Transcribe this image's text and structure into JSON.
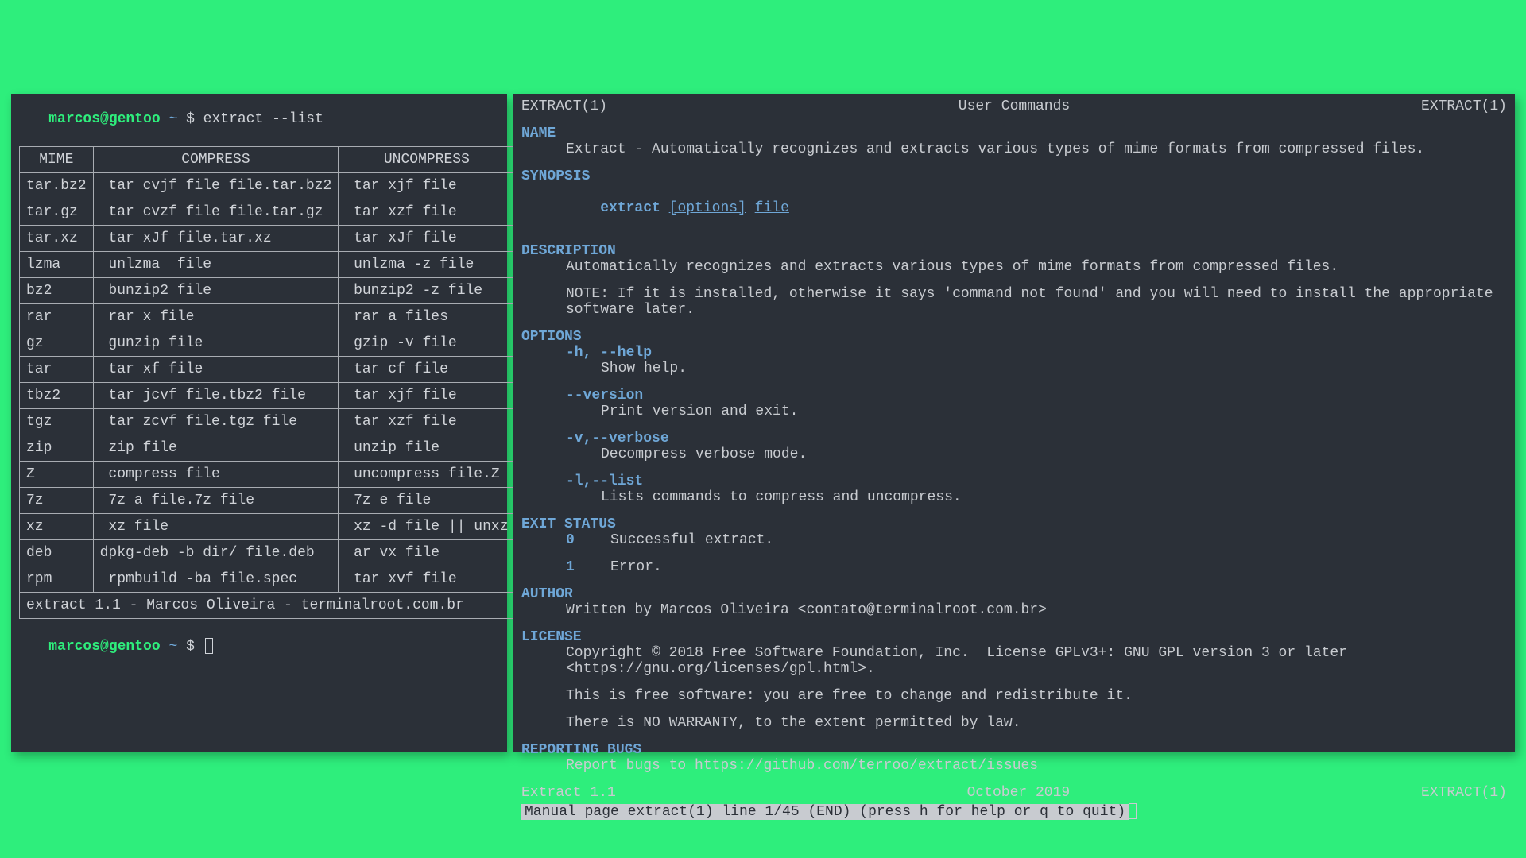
{
  "left": {
    "prompt_user": "marcos@gentoo",
    "prompt_tilde": " ~ ",
    "prompt_dollar": "$ ",
    "command": "extract --list",
    "headers": {
      "mime": "MIME",
      "compress": "COMPRESS",
      "uncompress": "UNCOMPRESS"
    },
    "rows": [
      {
        "mime": "tar.bz2",
        "compress": " tar cvjf file file.tar.bz2",
        "uncompress": " tar xjf file"
      },
      {
        "mime": "tar.gz",
        "compress": " tar cvzf file file.tar.gz",
        "uncompress": " tar xzf file"
      },
      {
        "mime": "tar.xz",
        "compress": " tar xJf file.tar.xz",
        "uncompress": " tar xJf file"
      },
      {
        "mime": "lzma",
        "compress": " unlzma  file",
        "uncompress": " unlzma -z file"
      },
      {
        "mime": "bz2",
        "compress": " bunzip2 file",
        "uncompress": " bunzip2 -z file"
      },
      {
        "mime": "rar",
        "compress": " rar x file",
        "uncompress": " rar a files"
      },
      {
        "mime": "gz",
        "compress": " gunzip file",
        "uncompress": " gzip -v file"
      },
      {
        "mime": "tar",
        "compress": " tar xf file",
        "uncompress": " tar cf file"
      },
      {
        "mime": "tbz2",
        "compress": " tar jcvf file.tbz2 file",
        "uncompress": " tar xjf file"
      },
      {
        "mime": "tgz",
        "compress": " tar zcvf file.tgz file",
        "uncompress": " tar xzf file"
      },
      {
        "mime": "zip",
        "compress": " zip file",
        "uncompress": " unzip file"
      },
      {
        "mime": "Z",
        "compress": " compress file",
        "uncompress": " uncompress file.Z"
      },
      {
        "mime": "7z",
        "compress": " 7z a file.7z file",
        "uncompress": " 7z e file"
      },
      {
        "mime": "xz",
        "compress": " xz file",
        "uncompress": " xz -d file || unxz"
      },
      {
        "mime": "deb",
        "compress": "dpkg-deb -b dir/ file.deb",
        "uncompress": " ar vx file"
      },
      {
        "mime": "rpm",
        "compress": " rpmbuild -ba file.spec",
        "uncompress": " tar xvf file"
      }
    ],
    "footer": "extract 1.1 - Marcos Oliveira - terminalroot.com.br"
  },
  "right": {
    "header_left": "EXTRACT(1)",
    "header_center": "User Commands",
    "header_right": "EXTRACT(1)",
    "name_head": "NAME",
    "name_text": "Extract - Automatically recognizes and extracts various types of mime formats from compressed files.",
    "synopsis_head": "SYNOPSIS",
    "synopsis_cmd": "extract ",
    "synopsis_opts": "[options]",
    "synopsis_file": "file",
    "description_head": "DESCRIPTION",
    "description_text": "Automatically recognizes and extracts various types of mime formats from compressed files.",
    "description_note": "NOTE: If it is installed, otherwise it says 'command not found' and you will need to install the appropriate software later.",
    "options_head": "OPTIONS",
    "options": [
      {
        "flag": "-h, --help",
        "text": "Show help."
      },
      {
        "flag": "--version",
        "text": "Print version and exit."
      },
      {
        "flag": "-v,--verbose",
        "text": "Decompress verbose mode."
      },
      {
        "flag": "-l,--list",
        "text": "Lists commands to compress and uncompress."
      }
    ],
    "exit_head": "EXIT STATUS",
    "exit_status": [
      {
        "code": "0",
        "text": "Successful extract."
      },
      {
        "code": "1",
        "text": "Error."
      }
    ],
    "author_head": "AUTHOR",
    "author_text": "Written by Marcos Oliveira <contato@terminalroot.com.br>",
    "license_head": "LICENSE",
    "license_line1": "Copyright © 2018 Free Software Foundation, Inc.  License GPLv3+: GNU GPL version 3 or later <https://gnu.org/licenses/gpl.html>.",
    "license_line2": "This is free software: you are free to change and redistribute it.",
    "license_line3": "There is NO WARRANTY, to the extent permitted by law.",
    "bugs_head": "REPORTING BUGS",
    "bugs_text": "Report bugs to https://github.com/terroo/extract/issues",
    "footer_left": "Extract 1.1",
    "footer_center": "October 2019",
    "footer_right": "EXTRACT(1)",
    "statusbar": " Manual page extract(1) line 1/45 (END) (press h for help or q to quit)"
  }
}
